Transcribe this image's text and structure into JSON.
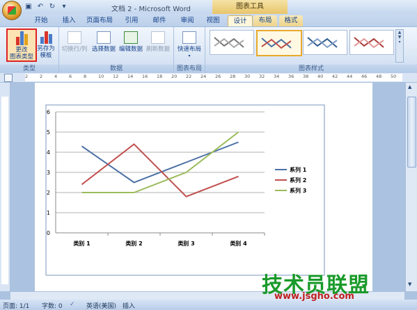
{
  "window": {
    "title": "文档 2 - Microsoft Word",
    "context_tool": "图表工具"
  },
  "tabs": [
    {
      "label": "开始"
    },
    {
      "label": "插入"
    },
    {
      "label": "页面布局"
    },
    {
      "label": "引用"
    },
    {
      "label": "邮件"
    },
    {
      "label": "审阅"
    },
    {
      "label": "视图"
    },
    {
      "label": "设计"
    },
    {
      "label": "布局"
    },
    {
      "label": "格式"
    }
  ],
  "ribbon": {
    "type_group": {
      "label": "类型",
      "change_type": "更改\n图表类型",
      "save_template": "另存为\n模板"
    },
    "data_group": {
      "label": "数据",
      "switch": "切换行/列",
      "select": "选择数据",
      "edit": "编辑数据",
      "refresh": "刷新数据"
    },
    "layout_group": {
      "label": "图表布局",
      "quick_layout": "快速布局"
    },
    "styles_group": {
      "label": "图表样式"
    }
  },
  "ruler": {
    "numbers": [
      "2",
      "2",
      "4",
      "6",
      "8",
      "10",
      "12",
      "14",
      "16",
      "18",
      "20",
      "22",
      "24",
      "26",
      "28",
      "30",
      "32",
      "34",
      "36",
      "38",
      "40",
      "42",
      "44",
      "46",
      "48",
      "50"
    ]
  },
  "chart_data": {
    "type": "line",
    "categories": [
      "类别 1",
      "类别 2",
      "类别 3",
      "类别 4"
    ],
    "series": [
      {
        "name": "系列 1",
        "values": [
          4.3,
          2.5,
          3.5,
          4.5
        ],
        "color": "#4a6fa5"
      },
      {
        "name": "系列 2",
        "values": [
          2.4,
          4.4,
          1.8,
          2.8
        ],
        "color": "#c0504d"
      },
      {
        "name": "系列 3",
        "values": [
          2.0,
          2.0,
          3.0,
          5.0
        ],
        "color": "#9bbb59"
      }
    ],
    "ylim": [
      0,
      6
    ],
    "yticks": [
      "0",
      "1",
      "2",
      "3",
      "4",
      "5",
      "6"
    ],
    "grid": true,
    "legend": "right"
  },
  "statusbar": {
    "page": "页面: 1/1",
    "words": "字数: 0",
    "lang": "英语(美国)",
    "mode": "插入"
  },
  "watermark": {
    "brand": "技术员联盟",
    "url": "www.jsgho.com"
  }
}
